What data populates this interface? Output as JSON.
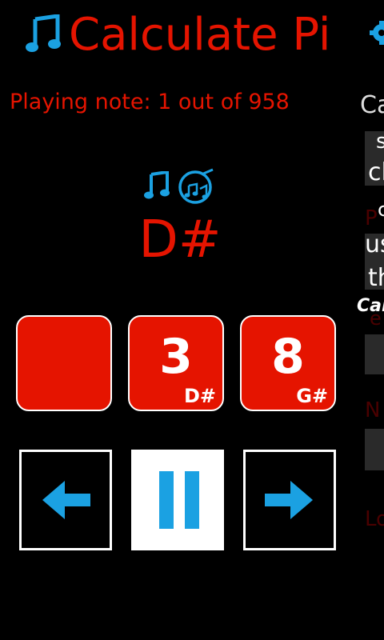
{
  "header": {
    "title": "Calculate Pi",
    "accent_color": "#1ba1e2",
    "title_color": "#e51400",
    "icons": [
      "music-note-icon",
      "gear-icon"
    ]
  },
  "status": {
    "text": "Playing note: 1 out of 958"
  },
  "current": {
    "note": "D#",
    "icons": [
      "music-note-icon",
      "music-disc-icon"
    ]
  },
  "tiles": [
    {
      "digit": "",
      "note": ""
    },
    {
      "digit": "3",
      "note": "D#"
    },
    {
      "digit": "8",
      "note": "G#"
    }
  ],
  "controls": {
    "previous": "arrow-left-icon",
    "pause": "pause-icon",
    "next": "arrow-right-icon"
  },
  "side_panel": {
    "heading": "Ca",
    "line1": "s",
    "line2": "cl",
    "line3": "c",
    "label_p": "P",
    "line4": "us",
    "line5": "th",
    "label_cal": "Cal",
    "label_e": "e",
    "label_n": "N",
    "label_lo": "Lo"
  }
}
